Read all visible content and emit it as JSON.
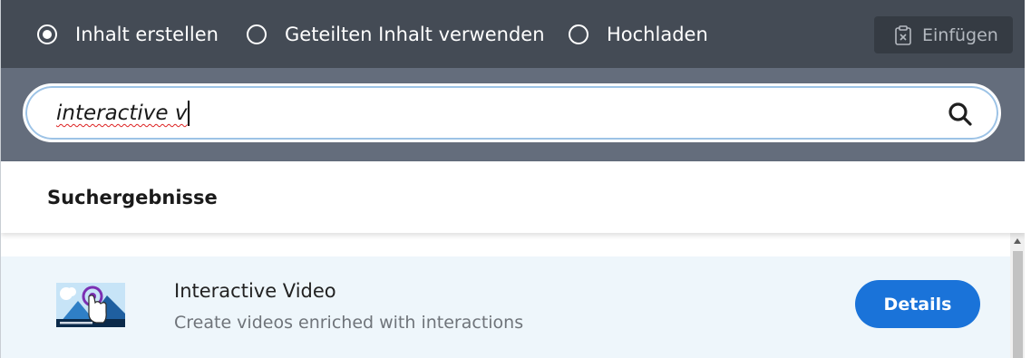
{
  "tabs": [
    {
      "label": "Inhalt erstellen",
      "selected": true
    },
    {
      "label": "Geteilten Inhalt verwenden",
      "selected": false
    },
    {
      "label": "Hochladen",
      "selected": false
    }
  ],
  "paste": {
    "label": "Einfügen",
    "icon": "clipboard-x-icon"
  },
  "search": {
    "value": "interactive v",
    "icon": "search-icon"
  },
  "results": {
    "heading": "Suchergebnisse",
    "items": [
      {
        "name": "Interactive Video",
        "description": "Create videos enriched with interactions",
        "button": "Details",
        "icon": "interactive-video-icon"
      }
    ]
  },
  "colors": {
    "tabbar": "#444b55",
    "searchband": "#646d7c",
    "accent": "#1a73d9",
    "item_bg": "#eef6fb"
  }
}
